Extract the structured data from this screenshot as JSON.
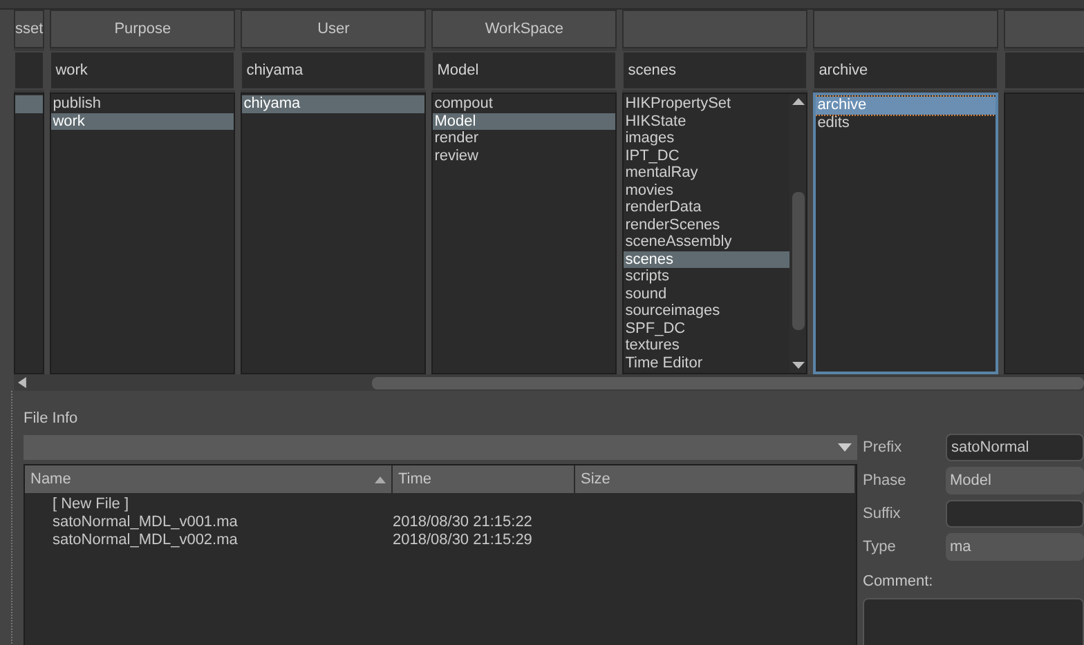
{
  "columns": [
    {
      "header": "sset",
      "focused": false,
      "scrollbar": false,
      "items": [
        {
          "selected": true
        }
      ]
    },
    {
      "header": "Purpose",
      "value": "work",
      "focused": false,
      "scrollbar": false,
      "items": [
        {
          "label": "publish",
          "selected": false
        },
        {
          "label": "work",
          "selected": true
        }
      ]
    },
    {
      "header": "User",
      "value": "chiyama",
      "focused": false,
      "scrollbar": false,
      "items": [
        {
          "label": "chiyama",
          "selected": true
        }
      ]
    },
    {
      "header": "WorkSpace",
      "value": "Model",
      "focused": false,
      "scrollbar": false,
      "items": [
        {
          "label": "compout",
          "selected": false
        },
        {
          "label": "Model",
          "selected": true
        },
        {
          "label": "render",
          "selected": false
        },
        {
          "label": "review",
          "selected": false
        }
      ]
    },
    {
      "value": "scenes",
      "focused": false,
      "scrollbar": true,
      "items": [
        {
          "label": "HIKPropertySet",
          "selected": false
        },
        {
          "label": "HIKState",
          "selected": false
        },
        {
          "label": "images",
          "selected": false
        },
        {
          "label": "IPT_DC",
          "selected": false
        },
        {
          "label": "mentalRay",
          "selected": false
        },
        {
          "label": "movies",
          "selected": false
        },
        {
          "label": "renderData",
          "selected": false
        },
        {
          "label": "renderScenes",
          "selected": false
        },
        {
          "label": "sceneAssembly",
          "selected": false
        },
        {
          "label": "scenes",
          "selected": true
        },
        {
          "label": "scripts",
          "selected": false
        },
        {
          "label": "sound",
          "selected": false
        },
        {
          "label": "sourceimages",
          "selected": false
        },
        {
          "label": "SPF_DC",
          "selected": false
        },
        {
          "label": "textures",
          "selected": false
        },
        {
          "label": "Time Editor",
          "selected": false
        }
      ]
    },
    {
      "value": "archive",
      "focused": true,
      "scrollbar": false,
      "items": [
        {
          "label": "archive",
          "selected": true
        },
        {
          "label": "edits",
          "selected": false
        }
      ]
    },
    {}
  ],
  "file_info": {
    "title": "File Info",
    "table": {
      "columns": [
        "Name",
        "Time",
        "Size"
      ],
      "rows": [
        {
          "name": "[ New File ]"
        },
        {
          "name": "satoNormal_MDL_v001.ma",
          "time": "2018/08/30 21:15:22"
        },
        {
          "name": "satoNormal_MDL_v002.ma",
          "time": "2018/08/30 21:15:29"
        }
      ]
    },
    "form": [
      {
        "label": "Prefix",
        "kind": "text",
        "value": "satoNormal"
      },
      {
        "label": "Phase",
        "kind": "combo",
        "value": "Model"
      },
      {
        "label": "Suffix",
        "kind": "text"
      },
      {
        "label": "Type",
        "kind": "combo",
        "value": "ma"
      }
    ],
    "comment_label": "Comment:"
  }
}
